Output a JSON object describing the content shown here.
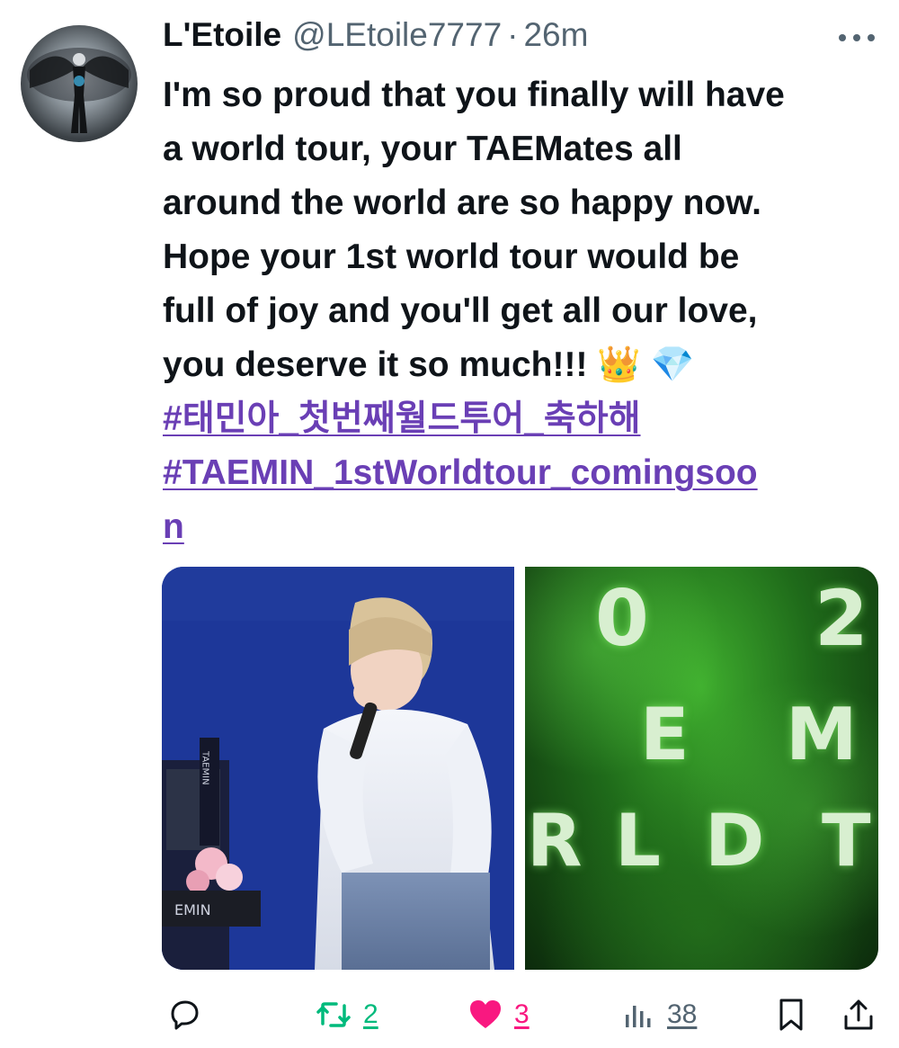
{
  "tweet": {
    "display_name": "L'Etoile",
    "handle": "@LEtoile7777",
    "separator": "·",
    "timestamp": "26m",
    "text_lines": [
      "I'm so proud that you finally will have",
      "a world tour, your TAEMates all",
      "around  the world are so happy now.",
      "Hope your 1st world tour would be",
      "full of joy and you'll get all our love,",
      "you deserve it so much!!!"
    ],
    "emojis": [
      "👑",
      "💎"
    ],
    "hashtags": [
      "#태민아_첫번째월드투어_축하해",
      "#TAEMIN_1stWorldtour_comingsoo",
      "n"
    ]
  },
  "media": {
    "left_image": {
      "banner_text": "TAEMIN",
      "sign_text": "EMIN"
    },
    "right_image": {
      "letters": [
        "0",
        "2",
        "E",
        "M",
        "R",
        "L",
        "D",
        "T"
      ]
    }
  },
  "actions": {
    "reply": {
      "icon": "reply-icon"
    },
    "retweet": {
      "icon": "retweet-icon",
      "count": "2"
    },
    "like": {
      "icon": "heart-icon",
      "count": "3"
    },
    "views": {
      "icon": "views-icon",
      "count": "38"
    },
    "bookmark": {
      "icon": "bookmark-icon"
    },
    "share": {
      "icon": "share-icon"
    }
  },
  "colors": {
    "text": "#0f1419",
    "secondary": "#536471",
    "hashtag": "#6a3fb5",
    "retweet": "#00ba7c",
    "like": "#f91880"
  }
}
